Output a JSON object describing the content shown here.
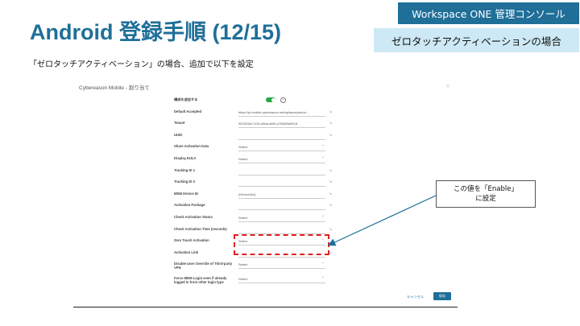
{
  "header": {
    "title": "Android 登録手順 (12/15)",
    "badge_console": "Workspace ONE 管理コンソール",
    "badge_case": "ゼロタッチアクティベーションの場合",
    "subtitle": "「ゼロタッチアクティベーション」の場合、追加で以下を設定"
  },
  "panel": {
    "title": "Cybereason Mobile - 割り当て",
    "close_glyph": "×",
    "toggle_on": true,
    "rows": [
      {
        "label": "構成を追加する",
        "value": "",
        "kind": "toggle"
      },
      {
        "label": "Default Accepted",
        "value": "https://pl.mobile.cybereason.net/api/accepts/c/u...",
        "kind": "text",
        "icon": "↘"
      },
      {
        "label": "Tenant",
        "value": "9f22518d-7c2b-46bb-a6f0-a7546f0a9018",
        "kind": "text",
        "icon": "↘"
      },
      {
        "label": "UUID",
        "value": "",
        "kind": "text",
        "icon": "↘"
      },
      {
        "label": "Share Activation Data",
        "value": "Select",
        "kind": "select"
      },
      {
        "label": "Display EULA",
        "value": "Select",
        "kind": "select"
      },
      {
        "label": "Tracking ID 1",
        "value": "",
        "kind": "text",
        "icon": "↘"
      },
      {
        "label": "Tracking ID 2",
        "value": "",
        "kind": "text",
        "icon": "↘"
      },
      {
        "label": "MDM Device ID",
        "value": "{DeviceUid}",
        "kind": "text",
        "icon": "↘"
      },
      {
        "label": "Activation Package",
        "value": "",
        "kind": "text",
        "icon": "↘"
      },
      {
        "label": "Check Activation Status",
        "value": "Select",
        "kind": "select"
      },
      {
        "label": "Check Activation Time (seconds)",
        "value": "",
        "kind": "text",
        "icon": "↘"
      },
      {
        "label": "Zero Touch Activation",
        "value": "Select",
        "kind": "select"
      },
      {
        "label": "Activation Link",
        "value": "",
        "kind": "text",
        "icon": "↘"
      },
      {
        "label": "Disable User Override of Third-party VPN",
        "value": "Select",
        "kind": "select",
        "tall": true
      },
      {
        "label": "Force MDM Login even if already logged in from other login type",
        "value": "Select",
        "kind": "select",
        "tall": true
      }
    ]
  },
  "callout": {
    "line1": "この値を「Enable」",
    "line2": "に設定"
  },
  "footer": {
    "cancel_label": "キャンセル",
    "save_label": "保存"
  },
  "colors": {
    "accent": "#1f6f99",
    "highlight": "#e02020",
    "toggle": "#27a844"
  }
}
